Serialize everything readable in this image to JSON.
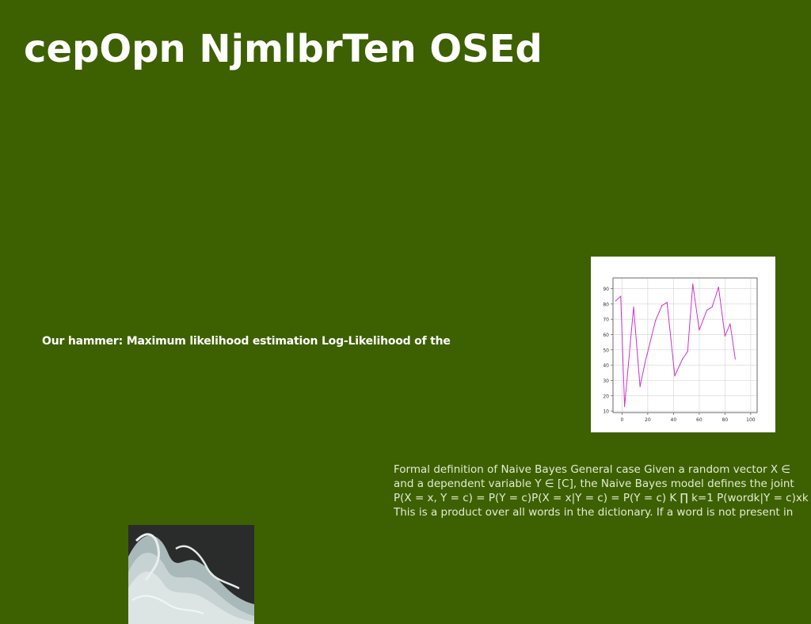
{
  "slide": {
    "title": "cepOpn NjmlbrTen OSEd",
    "subtitle": "Our hammer: Maximum likelihood estimation Log-Likelihood of the",
    "body_lines": [
      "Formal definition of Naive Bayes General case Given a random vector X ∈",
      "and a dependent variable Y ∈ [C], the Naive Bayes model defines the joint",
      "P(X = x, Y = c) = P(Y = c)P(X = x|Y = c) = P(Y = c) K ∏ k=1 P(wordk|Y = c)xk",
      "This is a product over all words in the dictionary. If a word is not present in"
    ]
  },
  "colors": {
    "background": "#3d6000",
    "title": "#ffffff",
    "body_text": "#e4ecd6",
    "chart_line": "#cc33cc"
  },
  "chart_data": {
    "type": "line",
    "x": [
      -5,
      0,
      5,
      10,
      15,
      20,
      25,
      30,
      35,
      40,
      45,
      50,
      55,
      60,
      65,
      70,
      75,
      80,
      85,
      90,
      95,
      100
    ],
    "series": [
      {
        "values": [
          82,
          85,
          13,
          78,
          26,
          42,
          69,
          79,
          81,
          33,
          44,
          49,
          93,
          63,
          76,
          78,
          91,
          59,
          67,
          44
        ]
      }
    ],
    "x_values_used": [
      -5,
      -1,
      2,
      9,
      14,
      18,
      26,
      31,
      35,
      41,
      47,
      51,
      55,
      60,
      66,
      70,
      75,
      80,
      84,
      88,
      93
    ],
    "xticks": [
      "0",
      "20",
      "40",
      "60",
      "80",
      "100"
    ],
    "yticks": [
      "10",
      "20",
      "30",
      "40",
      "50",
      "60",
      "70",
      "80",
      "90"
    ],
    "xlim": [
      -7,
      105
    ],
    "ylim": [
      9,
      97
    ],
    "grid": true
  }
}
